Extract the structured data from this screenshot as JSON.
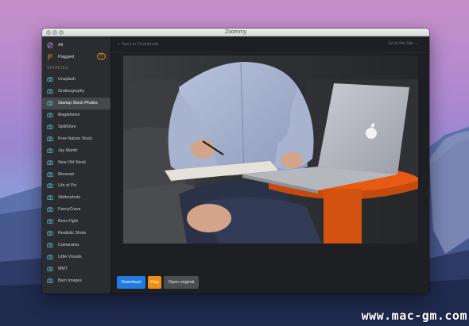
{
  "window": {
    "title": "Zoommy"
  },
  "sidebar": {
    "all_label": "All",
    "flagged_label": "Flagged",
    "flagged_count": "0",
    "sources_heading": "SOURCES",
    "sources": [
      {
        "label": "Unsplash"
      },
      {
        "label": "Gratisography"
      },
      {
        "label": "Startup Stock Photos",
        "active": true
      },
      {
        "label": "Magdeleine"
      },
      {
        "label": "SplitShire"
      },
      {
        "label": "Free Nature Stock"
      },
      {
        "label": "Jay Mantri"
      },
      {
        "label": "New Old Stock"
      },
      {
        "label": "Moveast"
      },
      {
        "label": "Life of Pix"
      },
      {
        "label": "Skitterphoto"
      },
      {
        "label": "FancyCrave"
      },
      {
        "label": "Boss Fight"
      },
      {
        "label": "Realistic Shots"
      },
      {
        "label": "Camarama"
      },
      {
        "label": "Little Visuals"
      },
      {
        "label": "MMT"
      },
      {
        "label": "Barn Images"
      }
    ]
  },
  "main": {
    "back_label": "Back to Thumbnails",
    "site_label": "Go to the Site →",
    "buttons": {
      "download": "Download",
      "flag": "Flag",
      "open_original": "Open original"
    }
  },
  "watermark": "www.mac-gm.com",
  "colors": {
    "accent_blue": "#1f7ce0",
    "accent_orange": "#ee8f13",
    "sidebar_bg": "#2b2c2f",
    "active_item_bg": "#45474b"
  }
}
